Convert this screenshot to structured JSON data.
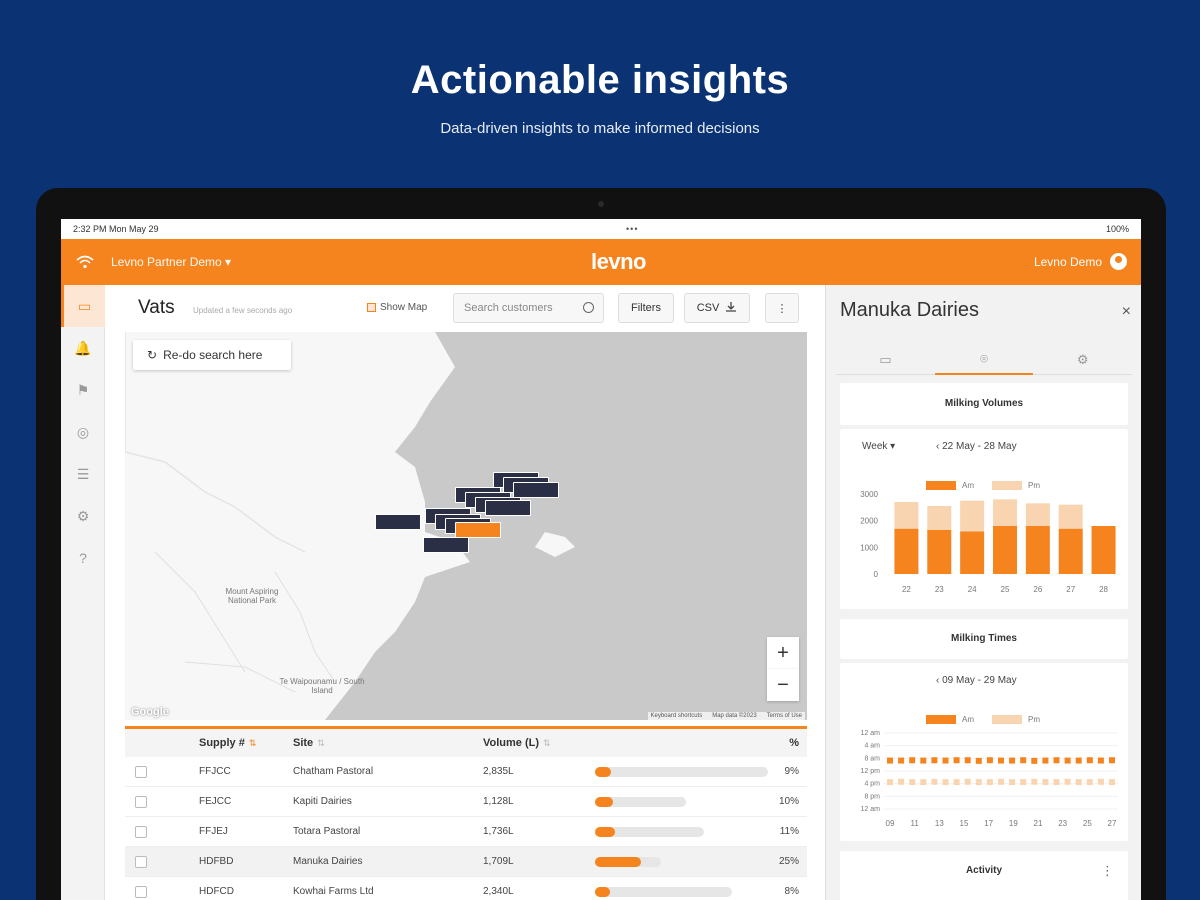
{
  "hero": {
    "title": "Actionable insights",
    "subtitle": "Data-driven insights to make informed decisions"
  },
  "status_bar": {
    "time": "2:32 PM  Mon May 29",
    "dots": "•••",
    "battery": "100%"
  },
  "topbar": {
    "account": "Levno Partner Demo ▾",
    "logo": "levno",
    "user": "Levno Demo",
    "wifi_icon": "wifi-icon",
    "user_icon": "user-avatar-icon"
  },
  "sidebar": {
    "items": [
      {
        "icon": "vat-icon",
        "glyph": "▭",
        "active": true
      },
      {
        "icon": "bell-icon",
        "glyph": "🔔",
        "active": false
      },
      {
        "icon": "flag-icon",
        "glyph": "⚑",
        "active": false
      },
      {
        "icon": "target-icon",
        "glyph": "◎",
        "active": false
      },
      {
        "icon": "list-icon",
        "glyph": "☰",
        "active": false
      },
      {
        "icon": "settings-icon",
        "glyph": "⚙",
        "active": false
      },
      {
        "icon": "help-icon",
        "glyph": "?",
        "active": false
      }
    ]
  },
  "toolbar": {
    "title": "Vats",
    "updated": "Updated a few seconds ago",
    "show_map": "Show Map",
    "search_placeholder": "Search customers",
    "filters": "Filters",
    "csv": "CSV",
    "more": "⋮"
  },
  "map": {
    "redo": "Re-do search here",
    "zoom_in": "+",
    "zoom_out": "−",
    "labels": [
      {
        "text": "Mount Aspiring National Park"
      },
      {
        "text": "Te Waipounamu / South Island"
      }
    ],
    "footer": [
      "Keyboard shortcuts",
      "Map data ©2023",
      "Terms of Use"
    ],
    "google": "Google"
  },
  "table": {
    "headers": {
      "supply": "Supply #",
      "site": "Site",
      "volume": "Volume (L)",
      "pct": "%"
    },
    "rows": [
      {
        "supply": "FFJCC",
        "site": "Chatham Pastoral",
        "volume": "2,835L",
        "bar_total": 0.95,
        "bar_fill": 0.09,
        "pct": "9%"
      },
      {
        "supply": "FEJCC",
        "site": "Kapiti Dairies",
        "volume": "1,128L",
        "bar_total": 0.5,
        "bar_fill": 0.1,
        "pct": "10%"
      },
      {
        "supply": "FFJEJ",
        "site": "Totara Pastoral",
        "volume": "1,736L",
        "bar_total": 0.6,
        "bar_fill": 0.11,
        "pct": "11%"
      },
      {
        "supply": "HDFBD",
        "site": "Manuka Dairies",
        "volume": "1,709L",
        "bar_total": 0.36,
        "bar_fill": 0.25,
        "pct": "25%"
      },
      {
        "supply": "HDFCD",
        "site": "Kowhai Farms Ltd",
        "volume": "2,340L",
        "bar_total": 0.75,
        "bar_fill": 0.08,
        "pct": "8%"
      }
    ]
  },
  "panel": {
    "title": "Manuka Dairies",
    "close": "×",
    "tabs": [
      {
        "icon": "vat-tab-icon",
        "glyph": "▭"
      },
      {
        "icon": "location-tab-icon",
        "glyph": "⌾"
      },
      {
        "icon": "settings-tab-icon",
        "glyph": "⚙"
      }
    ],
    "volumes": {
      "title": "Milking Volumes",
      "period": "Week ▾",
      "range": "‹ 22 May - 28 May",
      "legend_am": "Am",
      "legend_pm": "Pm"
    },
    "times": {
      "title": "Milking Times",
      "range": "‹ 09 May - 29 May",
      "legend_am": "Am",
      "legend_pm": "Pm"
    },
    "activity": {
      "title": "Activity",
      "more": "⋮"
    }
  },
  "colors": {
    "accent": "#f5841f",
    "accent_light": "#f9d4b0",
    "navy": "#0b3373",
    "marker": "#2b2f45"
  },
  "chart_data": [
    {
      "type": "bar",
      "title": "Milking Volumes",
      "categories": [
        "22",
        "23",
        "24",
        "25",
        "26",
        "27",
        "28"
      ],
      "series": [
        {
          "name": "Am",
          "values": [
            1700,
            1650,
            1600,
            1800,
            1800,
            1700,
            1800
          ]
        },
        {
          "name": "Pm",
          "values": [
            1000,
            900,
            1150,
            1000,
            850,
            900,
            0
          ]
        }
      ],
      "stacked": true,
      "yticks": [
        "3000",
        "2000",
        "1000",
        "0"
      ],
      "ylim": [
        0,
        3000
      ]
    },
    {
      "type": "scatter",
      "title": "Milking Times",
      "categories": [
        "09",
        "11",
        "13",
        "15",
        "17",
        "19",
        "21",
        "23",
        "25",
        "27"
      ],
      "series": [
        {
          "name": "Am",
          "values": [
            8.7,
            8.7,
            8.6,
            8.7,
            8.6,
            8.7,
            8.6,
            8.6,
            8.8,
            8.6,
            8.7,
            8.7,
            8.6,
            8.8,
            8.7,
            8.6,
            8.7,
            8.7,
            8.6,
            8.7,
            8.6
          ]
        },
        {
          "name": "Pm",
          "values": [
            15.5,
            15.4,
            15.5,
            15.5,
            15.4,
            15.5,
            15.5,
            15.4,
            15.5,
            15.5,
            15.4,
            15.5,
            15.5,
            15.4,
            15.5,
            15.5,
            15.4,
            15.5,
            15.5,
            15.4,
            15.5
          ]
        }
      ],
      "yticks": [
        "12 am",
        "4 am",
        "8 am",
        "12 pm",
        "4 pm",
        "8 pm",
        "12 am"
      ]
    }
  ]
}
